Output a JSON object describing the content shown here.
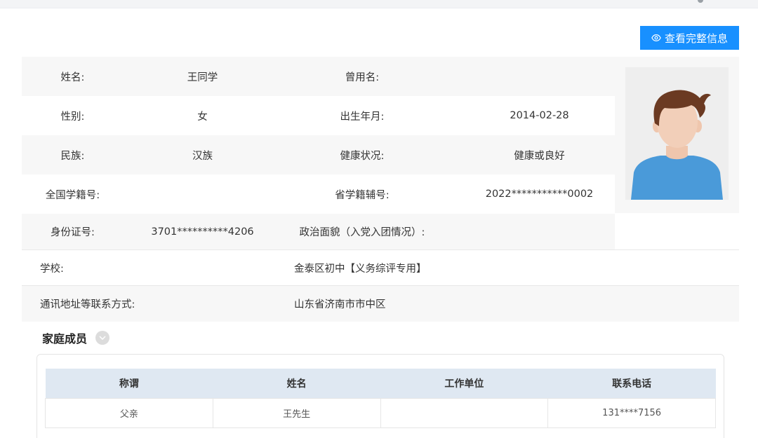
{
  "actions": {
    "view_full_info": "查看完整信息"
  },
  "student": {
    "name_label": "姓名:",
    "name_value": "王同学",
    "former_name_label": "曾用名:",
    "former_name_value": "",
    "gender_label": "性别:",
    "gender_value": "女",
    "birth_label": "出生年月:",
    "birth_value": "2014-02-28",
    "ethnicity_label": "民族:",
    "ethnicity_value": "汉族",
    "health_label": "健康状况:",
    "health_value": "健康或良好",
    "national_id_label": "全国学籍号:",
    "national_id_value": "",
    "provincial_id_label": "省学籍辅号:",
    "provincial_id_value": "2022***********0002",
    "idcard_label": "身份证号:",
    "idcard_value": "3701**********4206",
    "political_label": "政治面貌（入党入团情况）:",
    "political_value": "",
    "school_label": "学校:",
    "school_value": "金泰区初中【义务综评专用】",
    "address_label": "通讯地址等联系方式:",
    "address_value": "山东省济南市市中区"
  },
  "family": {
    "title": "家庭成员",
    "columns": [
      "称谓",
      "姓名",
      "工作单位",
      "联系电话"
    ],
    "rows": [
      [
        "父亲",
        "王先生",
        "",
        "131****7156"
      ]
    ]
  },
  "colors": {
    "primary": "#1890ff",
    "row_grey": "#f7f7f7",
    "table_header": "#dfe8f2",
    "avatar_hair": "#6b3a22",
    "avatar_skin": "#f2cfb9",
    "avatar_shirt": "#4a9ad9"
  },
  "icons": {
    "view_button_icon": "eye-icon",
    "section_toggle_icon": "chevron-down-icon",
    "photo": "avatar-placeholder"
  }
}
